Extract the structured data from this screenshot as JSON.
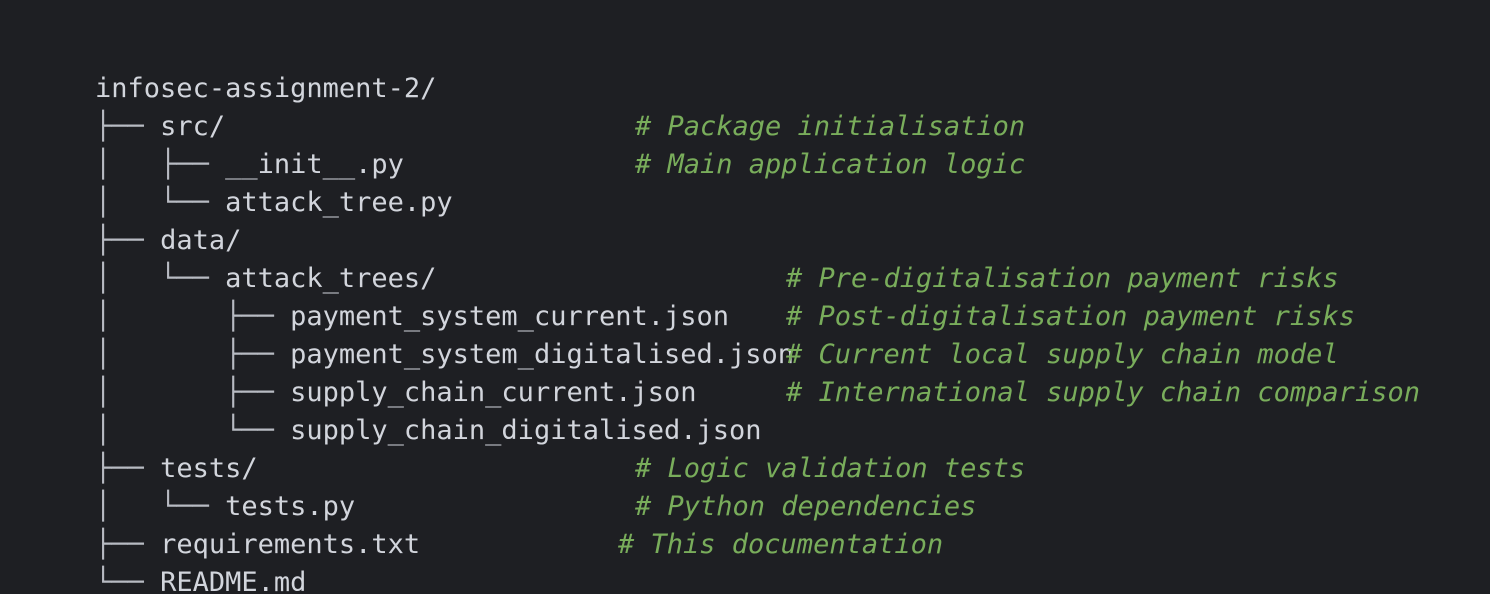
{
  "tree": {
    "root": "infosec-assignment-2/",
    "lines": [
      {
        "prefix": "├── ",
        "name": "src/",
        "comment": ""
      },
      {
        "prefix": "│   ├── ",
        "name": "__init__.py",
        "comment": "# Package initialisation"
      },
      {
        "prefix": "│   └── ",
        "name": "attack_tree.py",
        "comment": "# Main application logic"
      },
      {
        "prefix": "├── ",
        "name": "data/",
        "comment": ""
      },
      {
        "prefix": "│   └── ",
        "name": "attack_trees/",
        "comment": ""
      },
      {
        "prefix": "│       ├── ",
        "name": "payment_system_current.json",
        "comment": "# Pre-digitalisation payment risks"
      },
      {
        "prefix": "│       ├── ",
        "name": "payment_system_digitalised.json",
        "comment": "# Post-digitalisation payment risks"
      },
      {
        "prefix": "│       ├── ",
        "name": "supply_chain_current.json",
        "comment": "# Current local supply chain model"
      },
      {
        "prefix": "│       └── ",
        "name": "supply_chain_digitalised.json",
        "comment": "# International supply chain comparison"
      },
      {
        "prefix": "├── ",
        "name": "tests/",
        "comment": ""
      },
      {
        "prefix": "│   └── ",
        "name": "tests.py",
        "comment": "# Logic validation tests"
      },
      {
        "prefix": "├── ",
        "name": "requirements.txt",
        "comment": "# Python dependencies"
      },
      {
        "prefix": "└── ",
        "name": "README.md",
        "comment": "# This documentation"
      }
    ]
  },
  "colors": {
    "background": "#1e1f23",
    "text": "#d2d5dc",
    "comment": "#79ad5b"
  }
}
